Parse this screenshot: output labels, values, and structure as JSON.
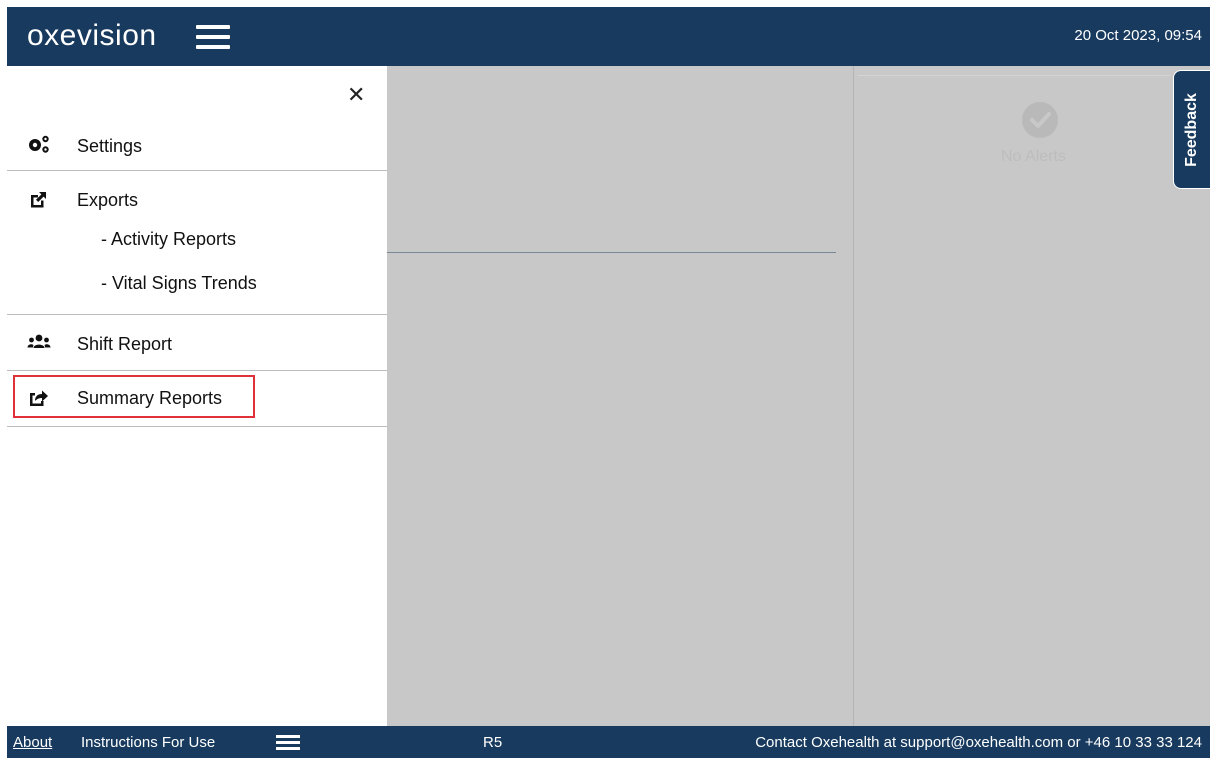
{
  "header": {
    "logo": "oxevision",
    "datetime": "20 Oct 2023, 09:54"
  },
  "drawer": {
    "settings_label": "Settings",
    "exports_label": "Exports",
    "exports_items": [
      "- Activity Reports",
      "- Vital Signs Trends"
    ],
    "shift_report_label": "Shift Report",
    "summary_reports_label": "Summary Reports"
  },
  "alerts": {
    "text": "No Alerts"
  },
  "feedback": {
    "label": "Feedback"
  },
  "footer": {
    "about": "About",
    "instructions": "Instructions For Use",
    "version": "R5",
    "contact": "Contact Oxehealth at support@oxehealth.com or +46 10 33 33 124"
  },
  "colors": {
    "navy": "#173a5e",
    "highlight": "#e0313b",
    "overlay_gray": "#c8c8c8"
  }
}
